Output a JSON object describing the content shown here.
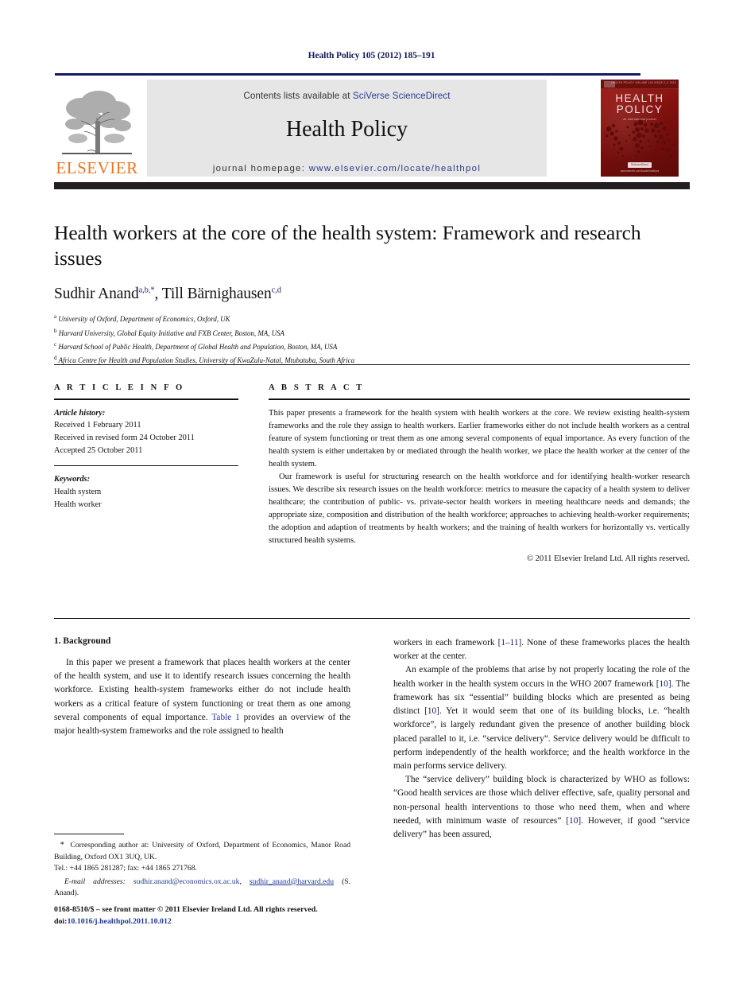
{
  "running_head": "Health Policy 105 (2012) 185–191",
  "masthead": {
    "contents_prefix": "Contents lists available at ",
    "sciencedirect": "SciVerse ScienceDirect",
    "journal_title": "Health Policy",
    "homepage_label": "journal homepage:",
    "homepage_url": "www.elsevier.com/locate/healthpol",
    "publisher_wordmark": "ELSEVIER",
    "accent_orange": "#e87722",
    "accent_navy": "#151a63",
    "link_blue": "#2a3b8f"
  },
  "cover": {
    "title_line1": "HEALTH",
    "title_line2": "POLICY",
    "subtitle": "an international journal",
    "top_strip": "HEALTH POLICY    VOLUME 105    ISSUE 2–3  2012",
    "badge": "ScienceDirect",
    "footer": "www.elsevier.com/locate/healthpol",
    "background_color": "#8c1410"
  },
  "article": {
    "title": "Health workers at the core of the health system: Framework and research issues",
    "authors": [
      {
        "name": "Sudhir Anand",
        "marks": "a,b,*"
      },
      {
        "name": "Till Bärnighausen",
        "marks": "c,d"
      }
    ],
    "authors_separator": ", ",
    "affiliations": [
      {
        "mark": "a",
        "text": "University of Oxford, Department of Economics, Oxford, UK"
      },
      {
        "mark": "b",
        "text": "Harvard University, Global Equity Initiative and FXB Center, Boston, MA, USA"
      },
      {
        "mark": "c",
        "text": "Harvard School of Public Health, Department of Global Health and Population, Boston, MA, USA"
      },
      {
        "mark": "d",
        "text": "Africa Centre for Health and Population Studies, University of KwaZulu-Natal, Mtubatuba, South Africa"
      }
    ]
  },
  "article_info": {
    "heading": "A R T I C L E    I N F O",
    "history_label": "Article history:",
    "history": [
      "Received 1 February 2011",
      "Received in revised form 24 October 2011",
      "Accepted 25 October 2011"
    ],
    "keywords_label": "Keywords:",
    "keywords": [
      "Health system",
      "Health worker"
    ]
  },
  "abstract": {
    "heading": "A B S T R A C T",
    "paragraphs": [
      "This paper presents a framework for the health system with health workers at the core. We review existing health-system frameworks and the role they assign to health workers. Earlier frameworks either do not include health workers as a central feature of system functioning or treat them as one among several components of equal importance. As every function of the health system is either undertaken by or mediated through the health worker, we place the health worker at the center of the health system.",
      "Our framework is useful for structuring research on the health workforce and for identifying health-worker research issues. We describe six research issues on the health workforce: metrics to measure the capacity of a health system to deliver healthcare; the contribution of public- vs. private-sector health workers in meeting healthcare needs and demands; the appropriate size, composition and distribution of the health workforce; approaches to achieving health-worker requirements; the adoption and adaption of treatments by health workers; and the training of health workers for horizontally vs. vertically structured health systems."
    ],
    "copyright": "© 2011 Elsevier Ireland Ltd. All rights reserved."
  },
  "body": {
    "section_number_title": "1. Background",
    "left_col": {
      "p1_a": "In this paper we present a framework that places health workers at the center of the health system, and use it to identify research issues concerning the health workforce. Existing health-system frameworks either do not include health workers as a critical feature of system functioning or treat them as one among several components of equal importance. ",
      "p1_link": "Table 1",
      "p1_b": " provides an overview of the major health-system frameworks and the role assigned to health"
    },
    "right_col": {
      "p1_cont_a": "workers in each framework ",
      "p1_cont_ref": "[1–11]",
      "p1_cont_b": ". None of these frameworks places the health worker at the center.",
      "p2_a": "An example of the problems that arise by not properly locating the role of the health worker in the health system occurs in the WHO 2007 framework ",
      "p2_ref1": "[10]",
      "p2_b": ". The framework has six “essential” building blocks which are presented as being distinct ",
      "p2_ref2": "[10]",
      "p2_c": ". Yet it would seem that one of its building blocks, i.e. “health workforce”, is largely redundant given the presence of another building block placed parallel to it, i.e. “service delivery”. Service delivery would be difficult to perform independently of the health workforce; and the health workforce in the main performs service delivery.",
      "p3_a": "The “service delivery” building block is characterized by WHO as follows: “Good health services are those which deliver effective, safe, quality personal and non-personal health interventions to those who need them, when and where needed, with minimum waste of resources” ",
      "p3_ref": "[10]",
      "p3_b": ". However, if good “service delivery” has been assured,"
    }
  },
  "footnote": {
    "star": "*",
    "corresponding": "Corresponding author at: University of Oxford, Department of Economics, Manor Road Building, Oxford OX1 3UQ, UK.",
    "tel": "Tel.: +44 1865 281287; fax: +44 1865 271768.",
    "email_label": "E-mail addresses:",
    "email1": "sudhir.anand@economics.ox.ac.uk",
    "email_sep": ", ",
    "email2": "sudhir_anand@harvard.edu",
    "email_attrib": " (S. Anand)."
  },
  "imprint": {
    "line1": "0168-8510/$ – see front matter © 2011 Elsevier Ireland Ltd. All rights reserved.",
    "doi_label": "doi:",
    "doi_value": "10.1016/j.healthpol.2011.10.012"
  }
}
